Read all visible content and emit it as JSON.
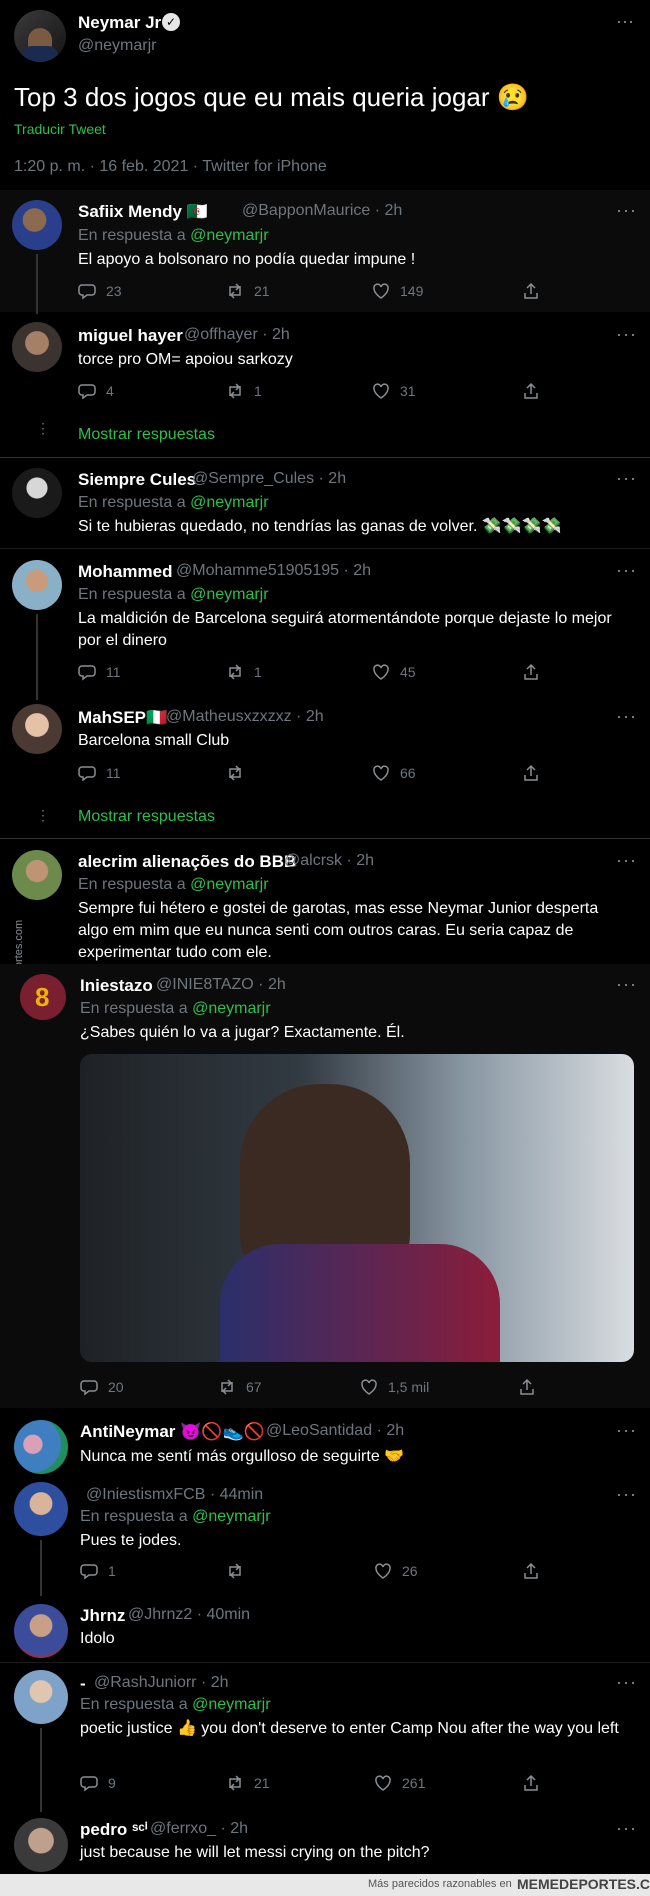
{
  "colors": {
    "accent": "#2fbf4a",
    "muted": "#6e767d",
    "bg": "#000000"
  },
  "main": {
    "name": "Neymar Jr",
    "handle": "@neymarjr",
    "text": "Top 3 dos jogos que eu mais queria jogar 😢",
    "translate": "Traducir Tweet",
    "meta": "1:20 p. m. · 16 feb. 2021 · Twitter for iPhone"
  },
  "replies": [
    {
      "name": "Safiix Mendy 🇩🇿",
      "handle": "@BapponMaurice · 2h",
      "replying": "En respuesta a ",
      "mention": "@neymarjr",
      "text": "El apoyo a bolsonaro no podía quedar impune !",
      "replies": "23",
      "retweets": "21",
      "likes": "149"
    },
    {
      "name": "miguel hayer",
      "handle": "@offhayer · 2h",
      "text": "torce pro OM= apoiou sarkozy",
      "replies": "4",
      "retweets": "1",
      "likes": "31"
    },
    {
      "name": "Siempre Cules",
      "handle": "@Sempre_Cules · 2h",
      "replying": "En respuesta a ",
      "mention": "@neymarjr",
      "text": "Si te hubieras quedado, no tendrías las ganas de volver. 💸💸💸💸"
    },
    {
      "name": "Mohammed",
      "handle": "@Mohamme51905195 · 2h",
      "replying": "En respuesta a ",
      "mention": "@neymarjr",
      "text": "La maldición de Barcelona seguirá atormentándote porque dejaste lo mejor por el dinero",
      "replies": "11",
      "retweets": "1",
      "likes": "45"
    },
    {
      "name": "MahSEP🇮🇹",
      "handle": "@Matheusxzxzxz · 2h",
      "text": "Barcelona small Club",
      "replies": "11",
      "retweets": "",
      "likes": "66"
    },
    {
      "name": "alecrim alienações do BBB",
      "handle": "@alcrsk · 2h",
      "replying": "En respuesta a ",
      "mention": "@neymarjr",
      "text": "Sempre fui hétero e gostei de garotas, mas esse Neymar Junior desperta algo em mim que eu nunca senti com outros caras. Eu seria capaz de experimentar tudo com ele."
    },
    {
      "name": "Iniestazo",
      "handle": "@INIE8TAZO · 2h",
      "replying": "En respuesta a ",
      "mention": "@neymarjr",
      "text": "¿Sabes quién lo va a jugar? Exactamente. Él.",
      "replies": "20",
      "retweets": "67",
      "likes": "1,5 mil"
    },
    {
      "name": "AntiNeymar 😈🚫👟🚫",
      "handle": "@LeoSantidad · 2h",
      "text": "Nunca me sentí más orgulloso de seguirte 🤝"
    },
    {
      "name": "",
      "handle": "@IniestismxFCB · 44min",
      "replying": "En respuesta a ",
      "mention": "@neymarjr",
      "text": "Pues te jodes.",
      "replies": "1",
      "retweets": "",
      "likes": "26"
    },
    {
      "name": "Jhrnz",
      "handle": "@Jhrnz2 · 40min",
      "text": "Idolo"
    },
    {
      "name": "-",
      "handle": "@RashJuniorr · 2h",
      "replying": "En respuesta a ",
      "mention": "@neymarjr",
      "text": "poetic justice 👍 you don't deserve to enter Camp Nou after the way you left",
      "replies": "9",
      "retweets": "21",
      "likes": "261"
    },
    {
      "name": "pedro ˢᶜⁱ",
      "handle": "@ferrxo_ · 2h",
      "text": "just because he will let messi crying on the pitch?"
    }
  ],
  "show_replies": "Mostrar respuestas",
  "watermark_side": "Memedeportes.com",
  "footer": {
    "text": "Más parecidos razonables en",
    "brand": "MEMEDEPORTES.COM"
  }
}
